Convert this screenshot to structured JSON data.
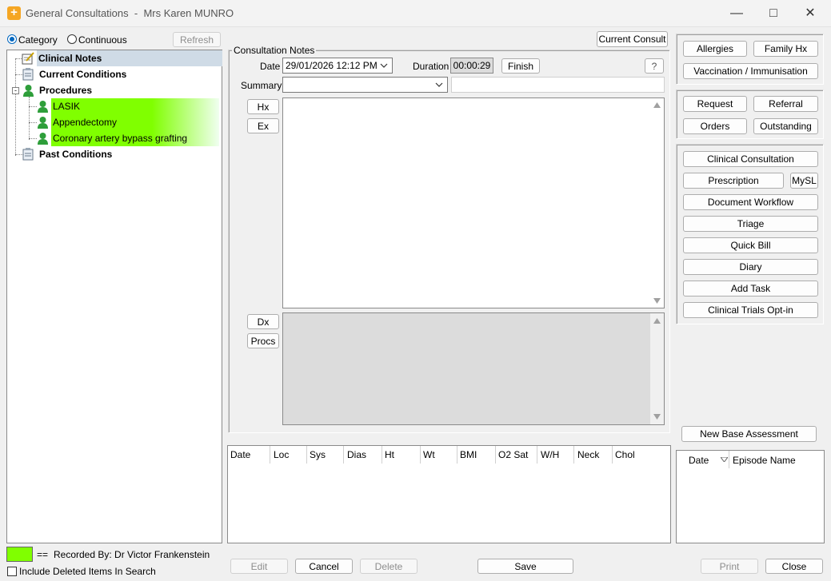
{
  "window": {
    "title": "General Consultations",
    "separator": "-",
    "patient": "Mrs Karen MUNRO",
    "minimize": "—",
    "maximize": "□",
    "close": "✕"
  },
  "view": {
    "category_label": "Category",
    "continuous_label": "Continuous",
    "selected": "Category",
    "refresh_label": "Refresh"
  },
  "tree": {
    "items": [
      {
        "label": "Clinical Notes",
        "icon": "notepad-icon"
      },
      {
        "label": "Current Conditions",
        "icon": "clipboard-icon"
      },
      {
        "label": "Procedures",
        "icon": "person-icon"
      },
      {
        "label": "LASIK",
        "icon": "person-icon"
      },
      {
        "label": "Appendectomy",
        "icon": "person-icon"
      },
      {
        "label": "Coronary artery bypass grafting",
        "icon": "person-icon"
      },
      {
        "label": "Past Conditions",
        "icon": "clipboard-icon"
      }
    ],
    "highlight_color": "#80ff00"
  },
  "consult": {
    "current_consult_label": "Current Consult",
    "group_label": "Consultation Notes",
    "date_label": "Date",
    "date_value": "29/01/2026  12:12 PM",
    "duration_label": "Duration",
    "duration_value": "00:00:29",
    "finish_label": "Finish",
    "help_label": "?",
    "summary_label": "Summary",
    "summary_value": "",
    "summary_extra": "",
    "hx_label": "Hx",
    "ex_label": "Ex",
    "dx_label": "Dx",
    "procs_label": "Procs"
  },
  "vitals": {
    "columns": [
      "Date",
      "Loc",
      "Sys",
      "Dias",
      "Ht",
      "Wt",
      "BMI",
      "O2 Sat",
      "W/H",
      "Neck",
      "Chol"
    ]
  },
  "right": {
    "group1": [
      "Allergies",
      "Family Hx",
      "Vaccination / Immunisation"
    ],
    "group2": [
      "Request",
      "Referral",
      "Orders",
      "Outstanding"
    ],
    "group3": [
      "Clinical Consultation",
      "Prescription",
      "MySL",
      "Document Workflow",
      "Triage",
      "Quick Bill",
      "Diary",
      "Add Task",
      "Clinical Trials Opt-in"
    ],
    "new_base_label": "New Base Assessment",
    "episode_cols": [
      "Date",
      "Episode Name"
    ]
  },
  "footer": {
    "legend_color": "#80ff00",
    "legend_eq": "==",
    "recorded_by": "Recorded By:  Dr Victor Frankenstein",
    "include_deleted": "Include Deleted Items In Search",
    "edit": "Edit",
    "cancel": "Cancel",
    "delete": "Delete",
    "save": "Save",
    "print": "Print",
    "close": "Close"
  }
}
